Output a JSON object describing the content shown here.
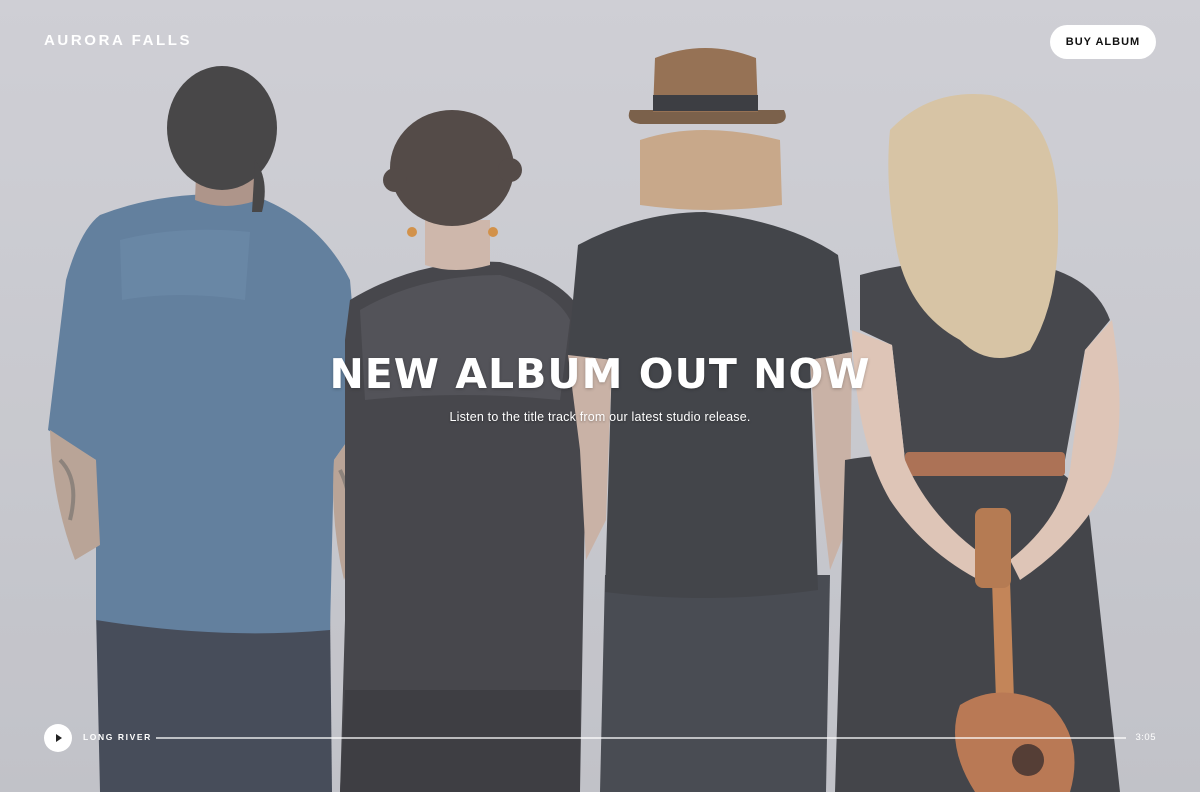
{
  "header": {
    "brand": "AURORA FALLS",
    "buy_label": "BUY ALBUM"
  },
  "hero": {
    "headline": "NEW ALBUM OUT NOW",
    "subtitle": "Listen to the title track from our latest studio release."
  },
  "player": {
    "play_icon": "play-icon",
    "track_title": "LONG RIVER",
    "duration": "3:05",
    "progress": 0
  },
  "colors": {
    "background": "#cbccd2",
    "text": "#ffffff",
    "button_bg": "#ffffff",
    "button_text": "#111111"
  }
}
